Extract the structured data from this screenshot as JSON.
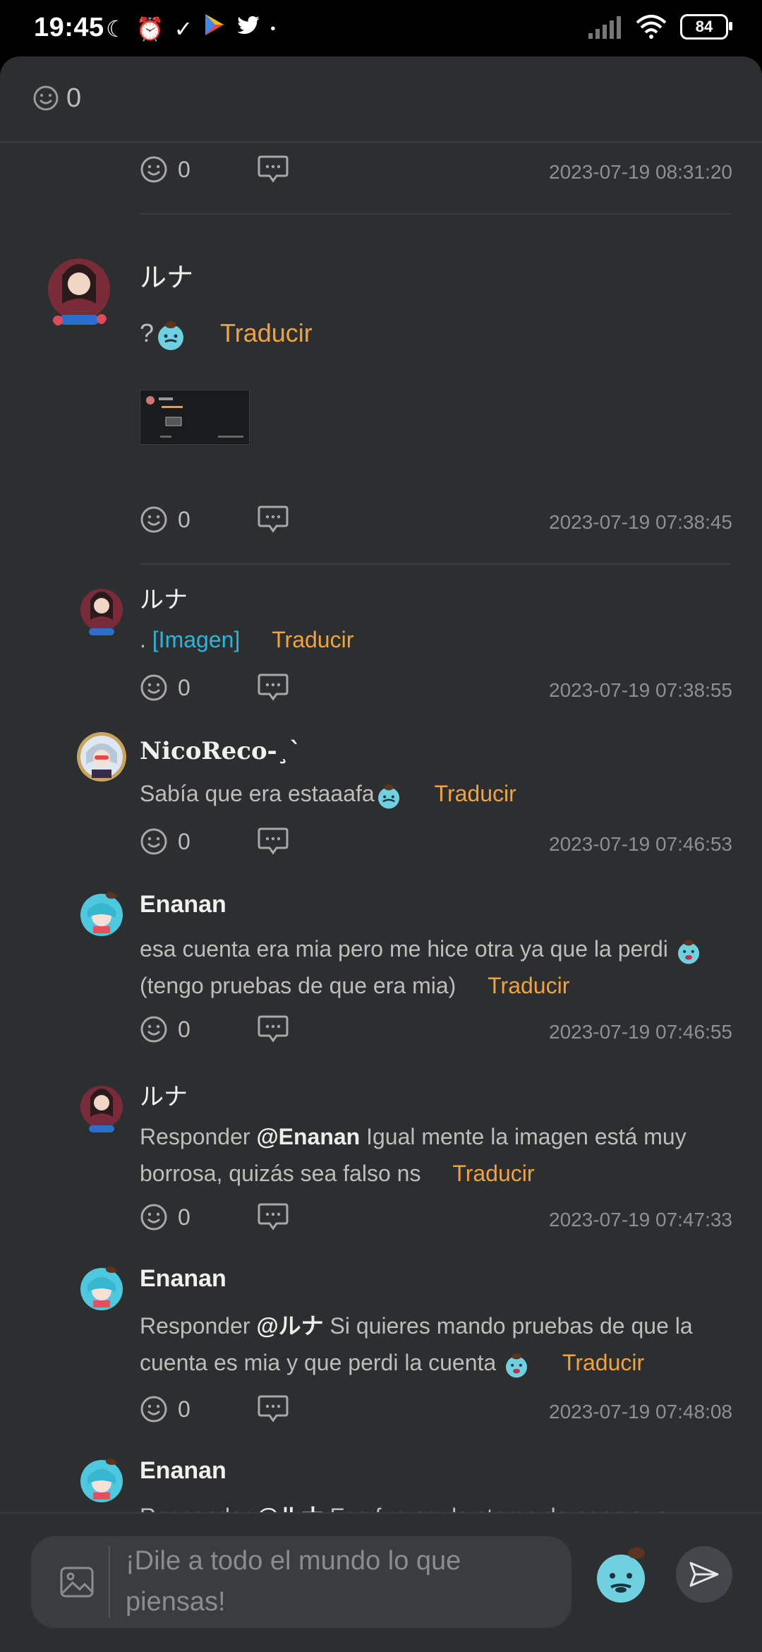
{
  "status": {
    "time": "19:45",
    "battery": "84"
  },
  "header": {
    "reaction_count": "0"
  },
  "top_actions": {
    "likes": "0",
    "date": "2023-07-19 08:31:20"
  },
  "post": {
    "author": "ルナ",
    "text_prefix": "?",
    "translate": "Traducir",
    "likes": "0",
    "date": "2023-07-19 07:38:45"
  },
  "replies": [
    {
      "author": "ルナ",
      "text_prefix": ". ",
      "image_link": "[Imagen]",
      "translate": "Traducir",
      "likes": "0",
      "date": "2023-07-19 07:38:55"
    },
    {
      "author": "NicoReco-¸`",
      "text": "Sabía que era estaaafa",
      "translate": "Traducir",
      "likes": "0",
      "date": "2023-07-19 07:46:53"
    },
    {
      "author": "Enanan",
      "text": "esa cuenta era mia pero me hice otra ya que la perdi ",
      "text2": "(tengo pruebas de que era mia)",
      "translate": "Traducir",
      "likes": "0",
      "date": "2023-07-19 07:46:55"
    },
    {
      "author": "ルナ",
      "reply_prefix": "Responder ",
      "mention": "@Enanan",
      "text": " Igual mente la imagen está muy borrosa, quizás sea falso ns",
      "translate": "Traducir",
      "likes": "0",
      "date": "2023-07-19 07:47:33"
    },
    {
      "author": "Enanan",
      "reply_prefix": "Responder ",
      "mention": "@ルナ",
      "text": " Si quieres mando pruebas de que la cuenta es mia y que perdi la cuenta ",
      "translate": "Traducir",
      "likes": "0",
      "date": "2023-07-19 07:48:08"
    },
    {
      "author": "Enanan",
      "reply_prefix": "Responder ",
      "mention": "@ルナ",
      "text": " Eso fue por lo stamp de pepe que"
    }
  ],
  "composer": {
    "placeholder": "¡Dile a todo el mundo lo que piensas!"
  },
  "colors": {
    "background": "#2d2e30",
    "translate": "#f0a33b",
    "link": "#29b6d9",
    "date": "#8e8f92"
  },
  "icons": [
    "moon-icon",
    "alarm-icon",
    "check-icon",
    "play-store-icon",
    "twitter-icon",
    "signal-icon",
    "wifi-icon",
    "smile-icon",
    "comment-icon",
    "image-icon",
    "send-icon",
    "sticker-icon"
  ]
}
